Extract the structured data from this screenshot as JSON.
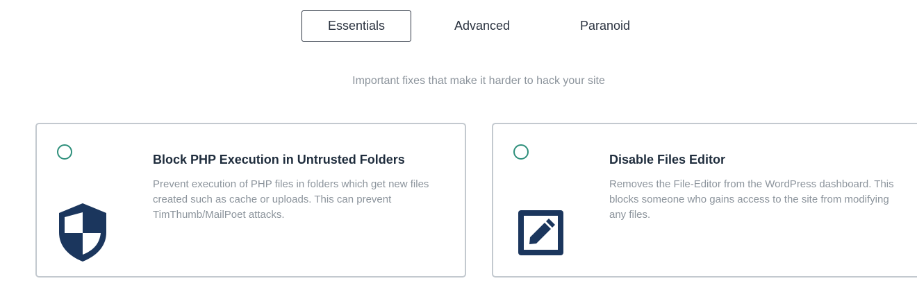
{
  "tabs": [
    {
      "label": "Essentials",
      "active": true
    },
    {
      "label": "Advanced",
      "active": false
    },
    {
      "label": "Paranoid",
      "active": false
    }
  ],
  "subtitle": "Important fixes that make it harder to hack your site",
  "cards": [
    {
      "title": "Block PHP Execution in Untrusted Folders",
      "description": "Prevent execution of PHP files in folders which get new files created such as cache or uploads. This can prevent TimThumb/MailPoet attacks.",
      "icon": "shield-icon",
      "selected": false
    },
    {
      "title": "Disable Files Editor",
      "description": "Removes the File-Editor from the WordPress dashboard. This blocks someone who gains access to the site from modifying any files.",
      "icon": "edit-icon",
      "selected": false
    }
  ],
  "colors": {
    "icon": "#1b365d",
    "radio": "#2e8f7b",
    "border": "#c3c9cf",
    "text_muted": "#8c949c",
    "title": "#1f2d3d"
  }
}
